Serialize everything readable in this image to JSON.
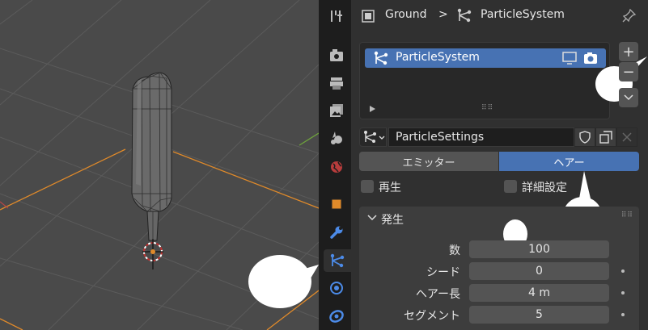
{
  "breadcrumb": {
    "object": "Ground",
    "separator": ">",
    "system": "ParticleSystem"
  },
  "particle_list": {
    "items": [
      {
        "label": "ParticleSystem",
        "selected": true
      }
    ]
  },
  "list_buttons": {
    "add": "+",
    "remove": "−"
  },
  "settings": {
    "name": "ParticleSettings"
  },
  "type_toggle": {
    "emitter": "エミッター",
    "hair": "ヘアー",
    "active": "hair"
  },
  "options": {
    "regrow": "再生",
    "advanced": "詳細設定"
  },
  "emission": {
    "title": "発生",
    "fields": [
      {
        "label": "数",
        "value": "100"
      },
      {
        "label": "シード",
        "value": "0"
      },
      {
        "label": "ヘアー長",
        "value": "4 m"
      },
      {
        "label": "セグメント",
        "value": "5"
      }
    ]
  },
  "colors": {
    "accent": "#4772b3",
    "active_tab_icon": "#4c8be8"
  }
}
